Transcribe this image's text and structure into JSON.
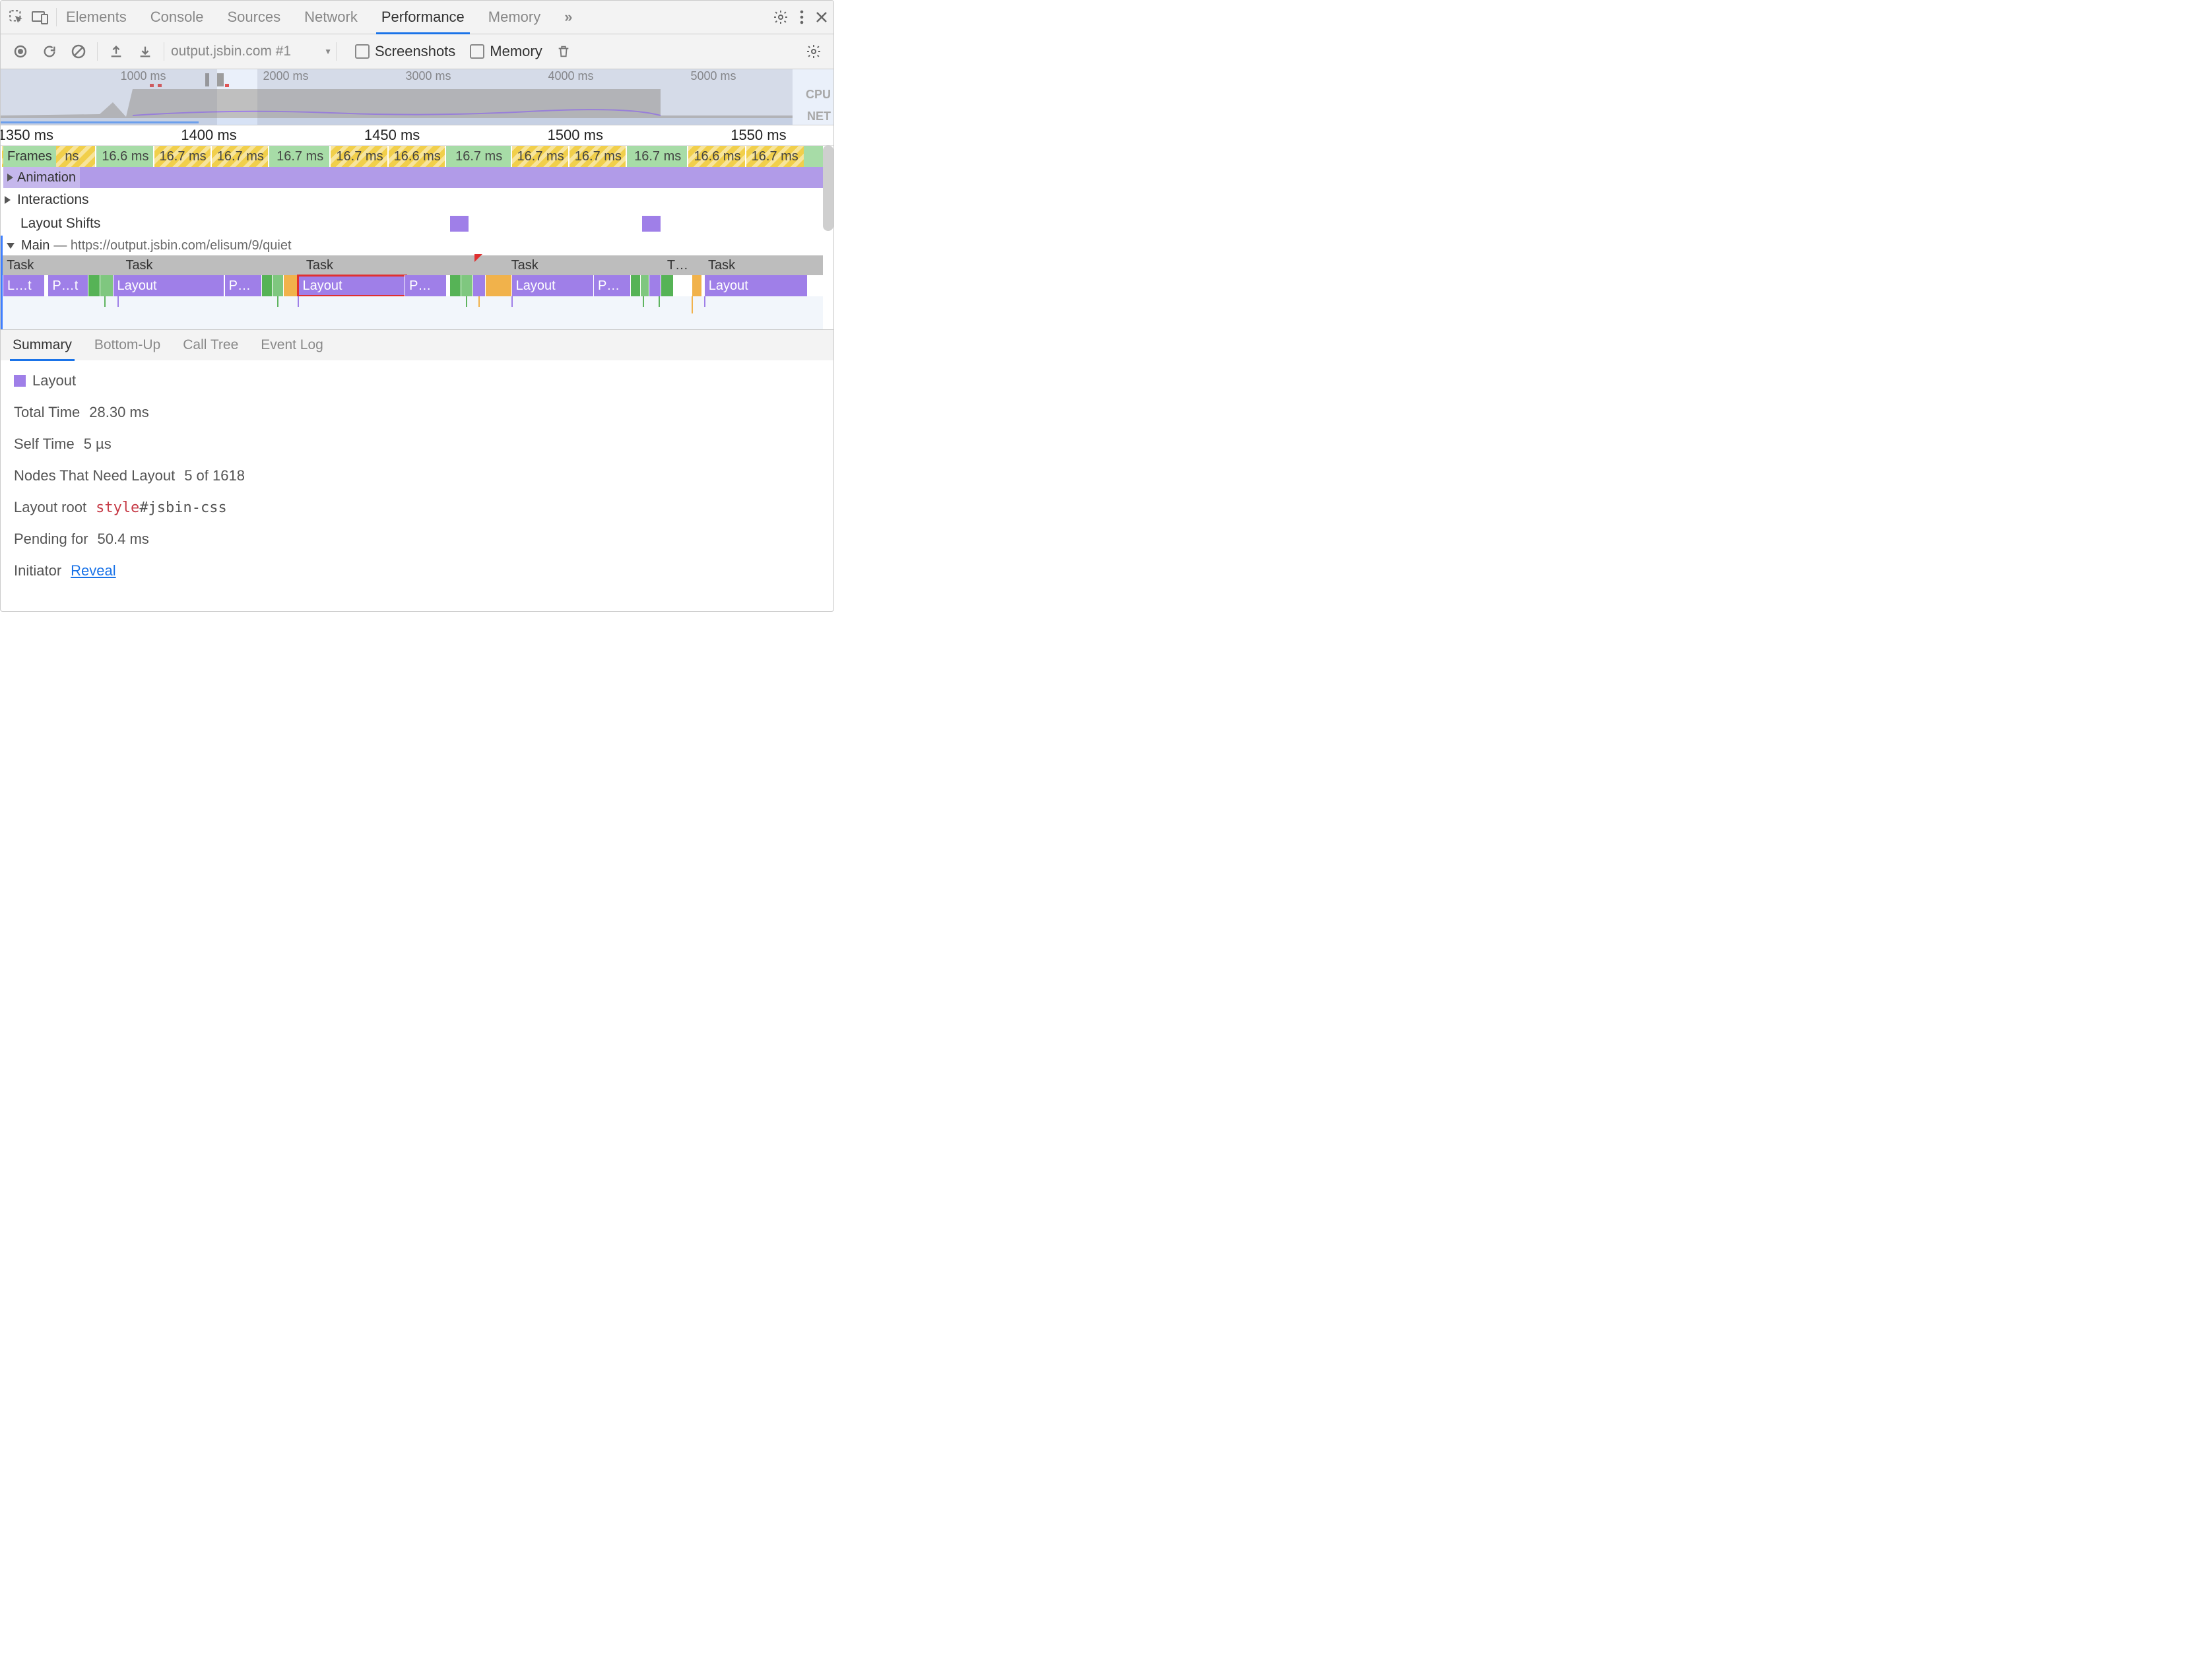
{
  "tabs": [
    "Elements",
    "Console",
    "Sources",
    "Network",
    "Performance",
    "Memory"
  ],
  "active_tab": "Performance",
  "more_tabs_glyph": "»",
  "toolbar": {
    "recording_select": "output.jsbin.com #1",
    "screenshots_label": "Screenshots",
    "memory_label": "Memory"
  },
  "overview": {
    "ticks": [
      "1000 ms",
      "2000 ms",
      "3000 ms",
      "4000 ms",
      "5000 ms"
    ],
    "side": [
      "CPU",
      "NET"
    ],
    "selection_range_ms": [
      1350,
      1570
    ]
  },
  "timeline": {
    "ruler": [
      "1350 ms",
      "1400 ms",
      "1450 ms",
      "1500 ms",
      "1550 ms"
    ],
    "frames_label": "Frames",
    "first_frame_fragment": "ns",
    "frame_durations": [
      "16.6 ms",
      "16.7 ms",
      "16.7 ms",
      "16.7 ms",
      "16.7 ms",
      "16.6 ms",
      "16.7 ms",
      "16.7 ms",
      "16.7 ms",
      "16.7 ms",
      "16.6 ms",
      "16.7 ms"
    ],
    "animation_label": "Animation",
    "interactions_label": "Interactions",
    "layout_shifts_label": "Layout Shifts",
    "main_label": "Main",
    "main_url": "https://output.jsbin.com/elisum/9/quiet",
    "task_label": "Task",
    "task_truncated": "T…",
    "flame": {
      "layout": "Layout",
      "layout_trunc": "L…t",
      "paint_trunc": "P…t",
      "p_ellipsis": "P…"
    }
  },
  "bottom_tabs": [
    "Summary",
    "Bottom-Up",
    "Call Tree",
    "Event Log"
  ],
  "active_bottom_tab": "Summary",
  "summary": {
    "title": "Layout",
    "rows": [
      {
        "k": "Total Time",
        "v": "28.30 ms"
      },
      {
        "k": "Self Time",
        "v": "5 µs"
      },
      {
        "k": "Nodes That Need Layout",
        "v": "5 of 1618"
      },
      {
        "k": "Layout root",
        "mono_red": "style",
        "mono_tail": "#jsbin-css"
      },
      {
        "k": "Pending for",
        "v": "50.4 ms"
      },
      {
        "k": "Initiator",
        "link": "Reveal"
      }
    ]
  }
}
